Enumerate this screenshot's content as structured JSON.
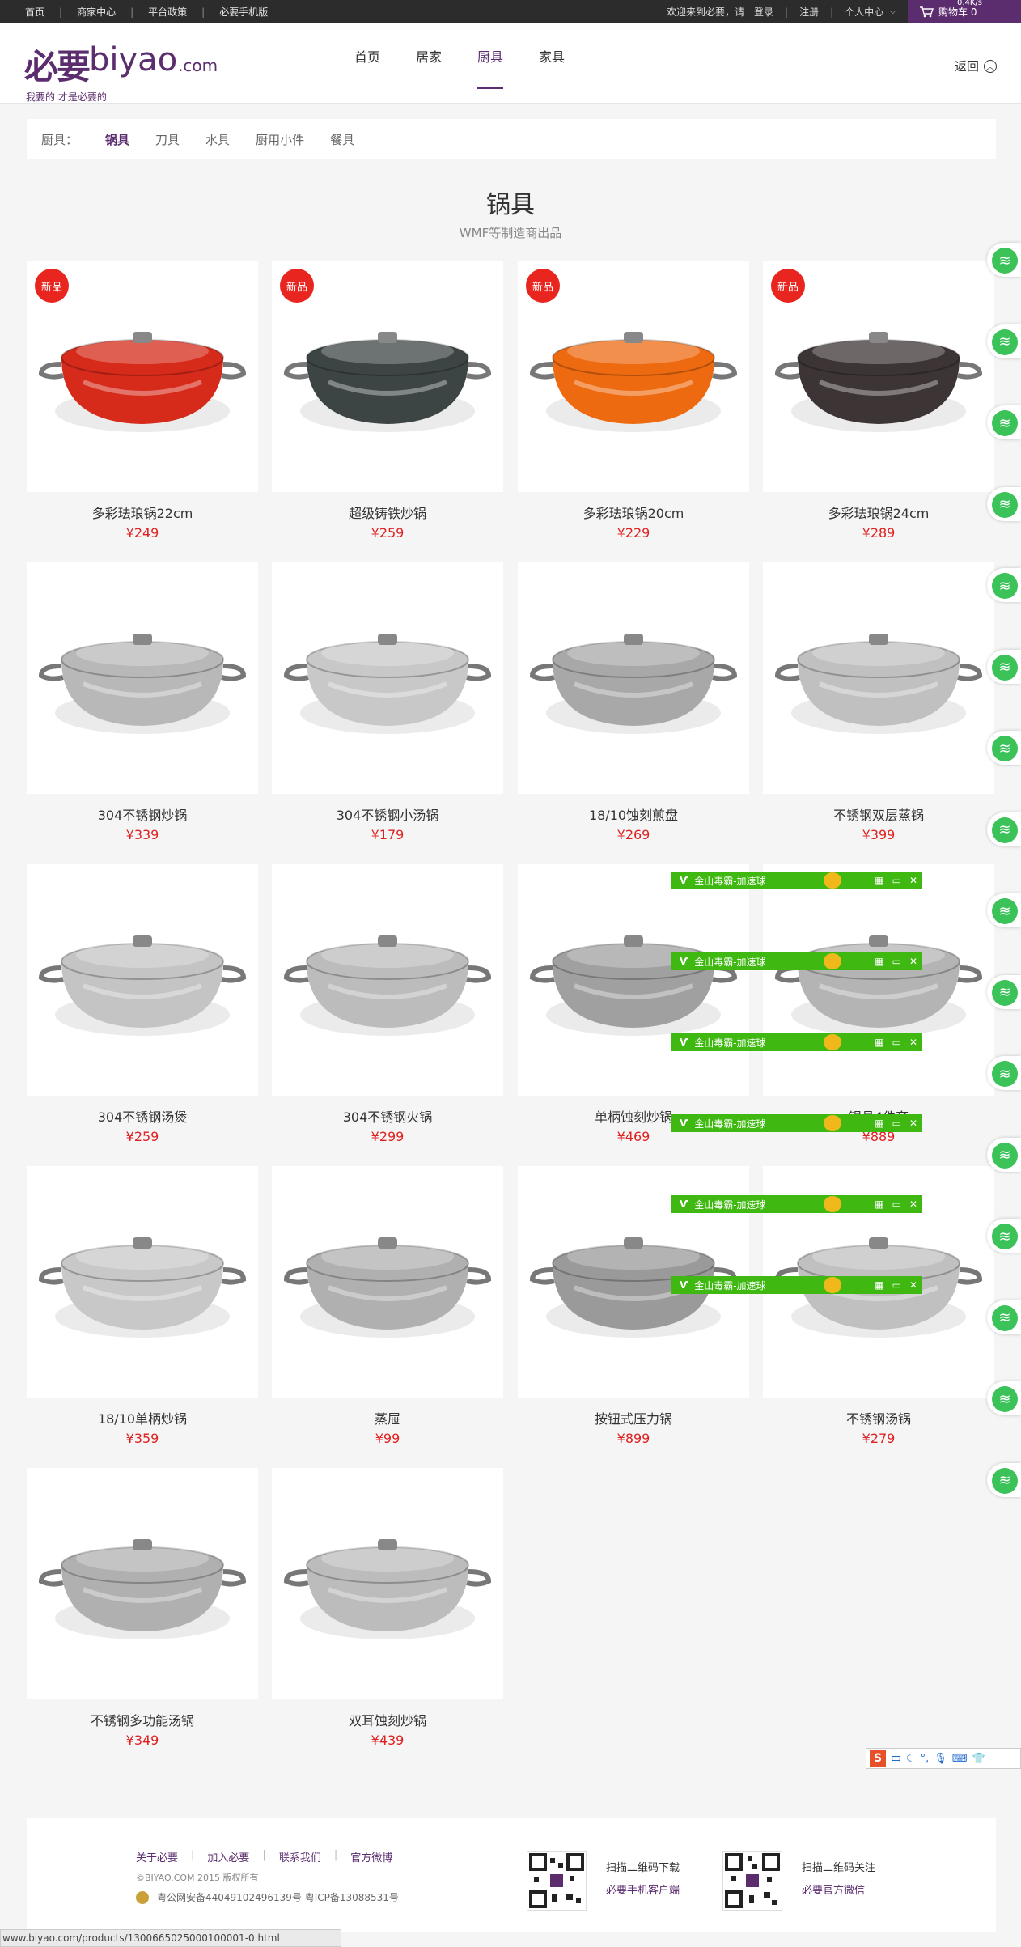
{
  "topbar": {
    "links": [
      "首页",
      "商家中心",
      "平台政策",
      "必要手机版"
    ],
    "welcome": "欢迎来到必要，请",
    "login": "登录",
    "register": "注册",
    "user_center": "个人中心",
    "cart": "购物车 0",
    "speed": "0.4K/s"
  },
  "header": {
    "logo_zh": "必要",
    "logo_en": "biyao",
    "logo_com": ".com",
    "slogan": "我要的 才是必要的",
    "nav": [
      "首页",
      "居家",
      "厨具",
      "家具"
    ],
    "nav_active": 2,
    "back": "返回"
  },
  "category": {
    "label": "厨具：",
    "items": [
      "锅具",
      "刀具",
      "水具",
      "厨用小件",
      "餐具"
    ],
    "active": 0
  },
  "section": {
    "title": "锅具",
    "subtitle": "WMF等制造商出品"
  },
  "products": [
    {
      "name": "多彩珐琅锅22cm",
      "price": "¥249",
      "badge": "新品",
      "color": "#d62a1a"
    },
    {
      "name": "超级铸铁炒锅",
      "price": "¥259",
      "badge": "新品",
      "color": "#3d4444"
    },
    {
      "name": "多彩珐琅锅20cm",
      "price": "¥229",
      "badge": "新品",
      "color": "#ee6a10"
    },
    {
      "name": "多彩珐琅锅24cm",
      "price": "¥289",
      "badge": "新品",
      "color": "#3c3435"
    },
    {
      "name": "304不锈钢炒锅",
      "price": "¥339",
      "badge": "",
      "color": "#b8b8b8"
    },
    {
      "name": "304不锈钢小汤锅",
      "price": "¥179",
      "badge": "",
      "color": "#c8c8c8"
    },
    {
      "name": "18/10蚀刻煎盘",
      "price": "¥269",
      "badge": "",
      "color": "#a8a8a8"
    },
    {
      "name": "不锈钢双层蒸锅",
      "price": "¥399",
      "badge": "",
      "color": "#c0c0c0"
    },
    {
      "name": "304不锈钢汤煲",
      "price": "¥259",
      "badge": "",
      "color": "#c4c4c4"
    },
    {
      "name": "304不锈钢火锅",
      "price": "¥299",
      "badge": "",
      "color": "#bcbcbc"
    },
    {
      "name": "单柄蚀刻炒锅",
      "price": "¥469",
      "badge": "",
      "color": "#a0a0a0"
    },
    {
      "name": "锅具4件套",
      "price": "¥889",
      "badge": "",
      "color": "#b4b4b4"
    },
    {
      "name": "18/10单柄炒锅",
      "price": "¥359",
      "badge": "",
      "color": "#c8c8c8"
    },
    {
      "name": "蒸屉",
      "price": "¥99",
      "badge": "",
      "color": "#b0b0b0"
    },
    {
      "name": "按钮式压力锅",
      "price": "¥899",
      "badge": "",
      "color": "#9a9a9a"
    },
    {
      "name": "不锈钢汤锅",
      "price": "¥279",
      "badge": "",
      "color": "#c0c0c0"
    },
    {
      "name": "不锈钢多功能汤锅",
      "price": "¥349",
      "badge": "",
      "color": "#b0b0b0"
    },
    {
      "name": "双耳蚀刻炒锅",
      "price": "¥439",
      "badge": "",
      "color": "#bcbcbc"
    }
  ],
  "overlay": {
    "jinshan_label": "金山毒霸-加速球",
    "ime": "中"
  },
  "footer": {
    "links": [
      "关于必要",
      "加入必要",
      "联系我们",
      "官方微博"
    ],
    "copyright": "©BIYAO.COM 2015 版权所有",
    "icp": "粤公网安备44049102496139号 粤ICP备13088531号",
    "qr1_line1": "扫描二维码下载",
    "qr1_line2": "必要手机客户端",
    "qr2_line1": "扫描二维码关注",
    "qr2_line2": "必要官方微信"
  },
  "status_url": "www.biyao.com/products/1300665025000100001-0.html"
}
